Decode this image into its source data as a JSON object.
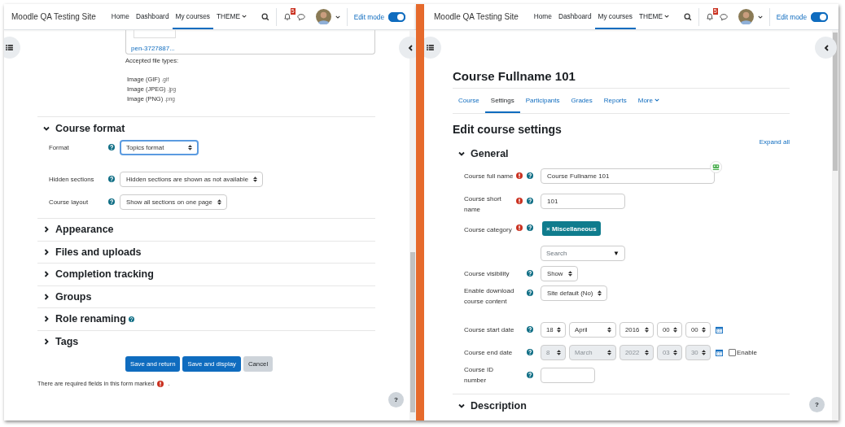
{
  "windows": [
    {
      "kind": "form_tail",
      "navbar": {
        "site_name": "Moodle QA Testing Site",
        "links": [
          {
            "label": "Home",
            "selected": false,
            "dropdown": false
          },
          {
            "label": "Dashboard",
            "selected": false,
            "dropdown": false
          },
          {
            "label": "My courses",
            "selected": true,
            "dropdown": false
          },
          {
            "label": "THEME",
            "selected": false,
            "dropdown": true
          }
        ],
        "notification_count": "5",
        "edit_mode": {
          "label": "Edit mode",
          "on": true
        }
      },
      "file_picker": {
        "filename": "pen-3727887...",
        "accepted_label": "Accepted file types:",
        "types": [
          {
            "name": "Image (GIF)",
            "ext": ".gif"
          },
          {
            "name": "Image (JPEG)",
            "ext": ".jpg"
          },
          {
            "name": "Image (PNG)",
            "ext": ".png"
          }
        ]
      },
      "course_format": {
        "title": "Course format",
        "expanded": true,
        "fields": [
          {
            "label": "Format",
            "value": "Topics format",
            "focused": true
          },
          {
            "label": "Hidden sections",
            "value": "Hidden sections are shown as not available",
            "focused": false
          },
          {
            "label": "Course layout",
            "value": "Show all sections on one page",
            "focused": false
          }
        ]
      },
      "sections": [
        {
          "title": "Appearance",
          "expanded": false,
          "help": false
        },
        {
          "title": "Files and uploads",
          "expanded": false,
          "help": false
        },
        {
          "title": "Completion tracking",
          "expanded": false,
          "help": false
        },
        {
          "title": "Groups",
          "expanded": false,
          "help": false
        },
        {
          "title": "Role renaming",
          "expanded": false,
          "help": true
        },
        {
          "title": "Tags",
          "expanded": false,
          "help": false
        }
      ],
      "buttons": [
        {
          "label": "Save and return",
          "kind": "primary"
        },
        {
          "label": "Save and display",
          "kind": "primary"
        },
        {
          "label": "Cancel",
          "kind": "secondary"
        }
      ],
      "required_note": {
        "text": "There are required fields in this form marked",
        "end": "."
      },
      "help_button": "?"
    },
    {
      "kind": "course_settings",
      "navbar": {
        "site_name": "Moodle QA Testing Site",
        "links": [
          {
            "label": "Home",
            "selected": false,
            "dropdown": false
          },
          {
            "label": "Dashboard",
            "selected": false,
            "dropdown": false
          },
          {
            "label": "My courses",
            "selected": true,
            "dropdown": false
          },
          {
            "label": "THEME",
            "selected": false,
            "dropdown": true
          }
        ],
        "notification_count": "5",
        "edit_mode": {
          "label": "Edit mode",
          "on": true
        }
      },
      "course_title": "Course Fullname 101",
      "tabs": [
        {
          "label": "Course",
          "selected": false,
          "dropdown": false
        },
        {
          "label": "Settings",
          "selected": true,
          "dropdown": false
        },
        {
          "label": "Participants",
          "selected": false,
          "dropdown": false
        },
        {
          "label": "Grades",
          "selected": false,
          "dropdown": false
        },
        {
          "label": "Reports",
          "selected": false,
          "dropdown": false
        },
        {
          "label": "More",
          "selected": false,
          "dropdown": true
        }
      ],
      "heading": "Edit course settings",
      "expand_all": "Expand all",
      "general": {
        "title": "General",
        "expanded": true,
        "fields": [
          {
            "kind": "text",
            "label": "Course full name",
            "required": true,
            "value": "Course Fullname 101"
          },
          {
            "kind": "text",
            "label": "Course short name",
            "required": true,
            "value": "101"
          },
          {
            "kind": "autocomplete",
            "label": "Course category",
            "required": true,
            "tag_remove": "×",
            "tag": "Miscellaneous",
            "placeholder": "Search",
            "caret": "▼"
          },
          {
            "kind": "select",
            "label": "Course visibility",
            "required": false,
            "value": "Show"
          },
          {
            "kind": "select",
            "label": "Enable download course content",
            "required": false,
            "value": "Site default (No)"
          },
          {
            "kind": "date",
            "label": "Course start date",
            "required": false,
            "disabled": false,
            "parts": [
              "18",
              "April",
              "2016",
              "00",
              "00"
            ]
          },
          {
            "kind": "date",
            "label": "Course end date",
            "required": false,
            "disabled": true,
            "parts": [
              "8",
              "March",
              "2022",
              "03",
              "30"
            ],
            "enable": {
              "label": "Enable",
              "checked": false
            }
          },
          {
            "kind": "text",
            "label": "Course ID number",
            "required": false
          }
        ]
      },
      "description": {
        "title": "Description",
        "expanded": true
      },
      "help_button": "?"
    }
  ]
}
